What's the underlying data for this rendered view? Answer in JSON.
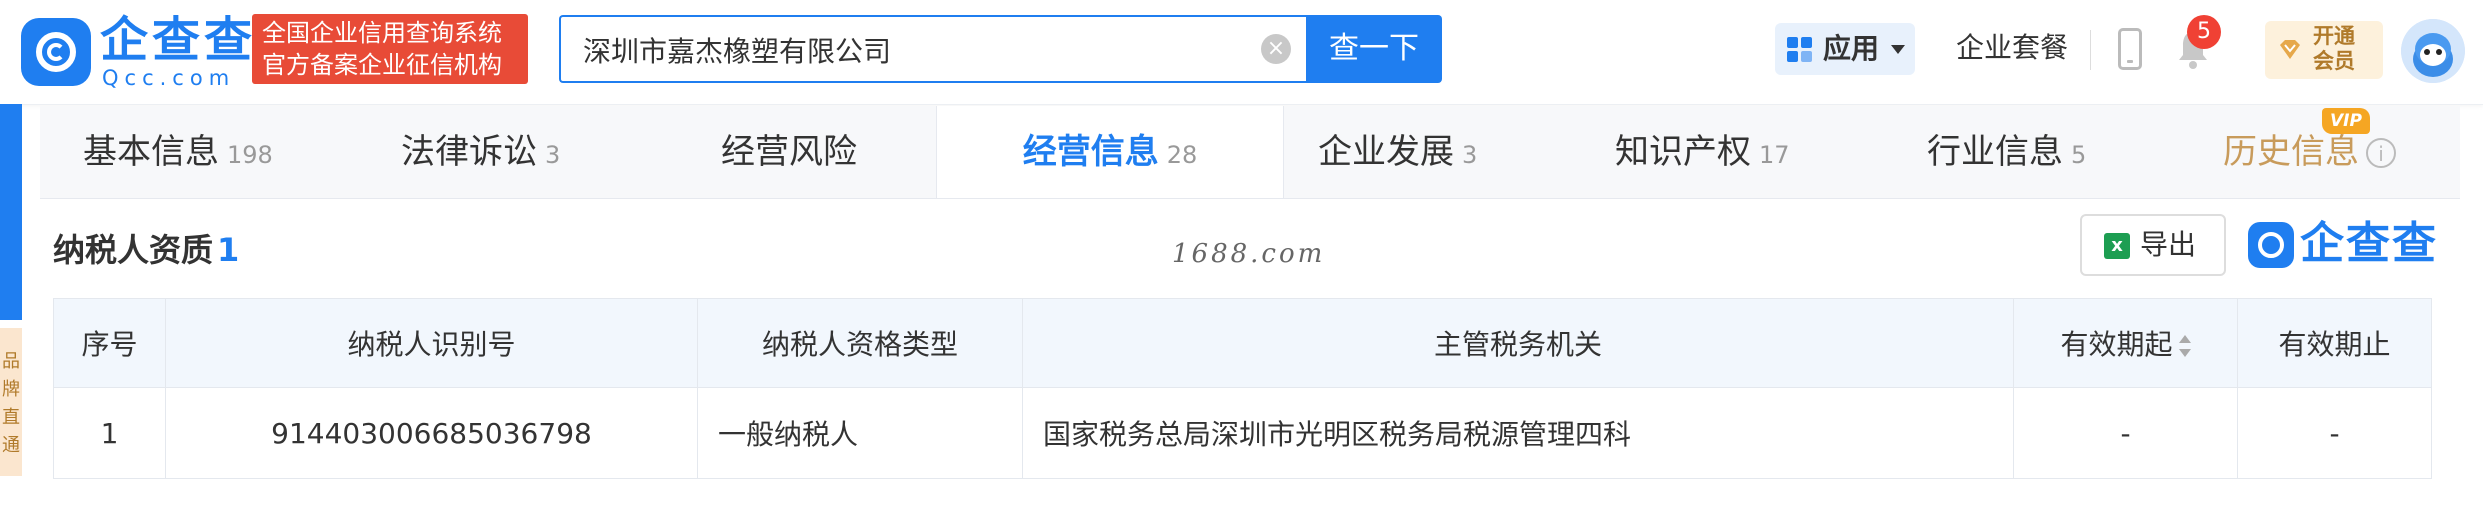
{
  "header": {
    "logo_cn": "企查查",
    "logo_en": "Qcc.com",
    "slogan_line1": "全国企业信用查询系统",
    "slogan_line2": "官方备案企业征信机构",
    "search_value": "深圳市嘉杰橡塑有限公司",
    "search_button": "查一下",
    "app_label": "应用",
    "package_link": "企业套餐",
    "notification_count": "5",
    "vip_line1": "开通",
    "vip_line2": "会员"
  },
  "side_strip": {
    "text": "品牌直通"
  },
  "tabs": [
    {
      "label": "基本信息",
      "count": "198"
    },
    {
      "label": "法律诉讼",
      "count": "3"
    },
    {
      "label": "经营风险",
      "count": ""
    },
    {
      "label": "经营信息",
      "count": "28"
    },
    {
      "label": "企业发展",
      "count": "3"
    },
    {
      "label": "知识产权",
      "count": "17"
    },
    {
      "label": "行业信息",
      "count": "5"
    },
    {
      "label": "历史信息",
      "count": ""
    }
  ],
  "history_tag": "VIP",
  "active_tab_index": 3,
  "section": {
    "title": "纳税人资质",
    "count": "1",
    "watermark": "1688.com",
    "export_label": "导出",
    "logo_cn": "企查查"
  },
  "table": {
    "headers": [
      "序号",
      "纳税人识别号",
      "纳税人资格类型",
      "主管税务机关",
      "有效期起",
      "有效期止"
    ],
    "rows": [
      [
        "1",
        "914403006685036798",
        "一般纳税人",
        "国家税务总局深圳市光明区税务局税源管理四科",
        "-",
        "-"
      ]
    ]
  },
  "colors": {
    "brand_blue": "#1f7ef0",
    "slogan_red": "#e84b37",
    "vip_gold": "#c89b5b",
    "badge_red": "#f04134"
  }
}
